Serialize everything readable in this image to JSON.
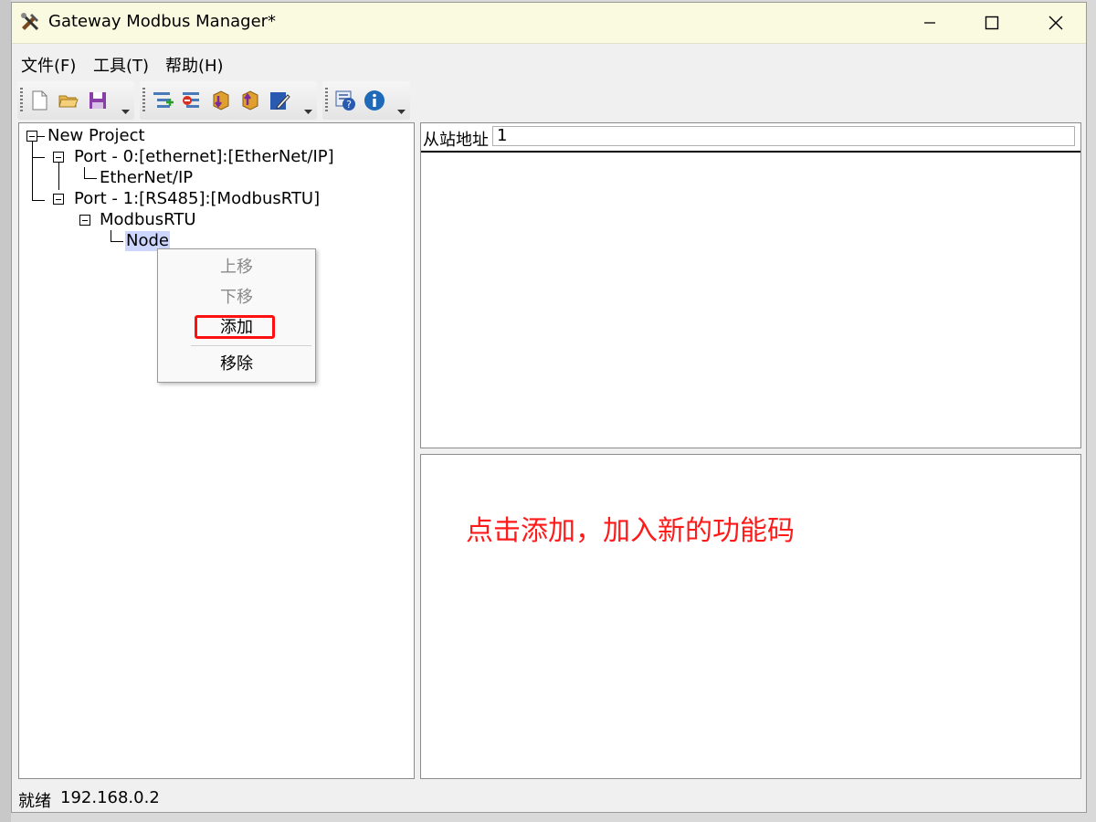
{
  "window": {
    "title": "Gateway Modbus Manager*"
  },
  "menu": {
    "items": [
      "文件(F)",
      "工具(T)",
      "帮助(H)"
    ]
  },
  "toolbar": {
    "icons": [
      "new-file-icon",
      "open-folder-icon",
      "save-icon",
      "tree-add-icon",
      "tree-remove-icon",
      "download-icon",
      "upload-icon",
      "edit-icon",
      "help-icon",
      "info-icon"
    ]
  },
  "tree": {
    "root": "New Project",
    "port0": "Port - 0:[ethernet]:[EtherNet/IP]",
    "port0_child": "EtherNet/IP",
    "port1": "Port - 1:[RS485]:[ModbusRTU]",
    "port1_child": "ModbusRTU",
    "node": "Node"
  },
  "properties": {
    "slave_address_label": "从站地址",
    "slave_address_value": "1"
  },
  "context_menu": {
    "move_up": "上移",
    "move_down": "下移",
    "add": "添加",
    "remove": "移除"
  },
  "annotation": {
    "text": "点击添加，加入新的功能码",
    "color": "#ff1a1a"
  },
  "status": {
    "state": "就绪",
    "ip": "192.168.0.2"
  }
}
